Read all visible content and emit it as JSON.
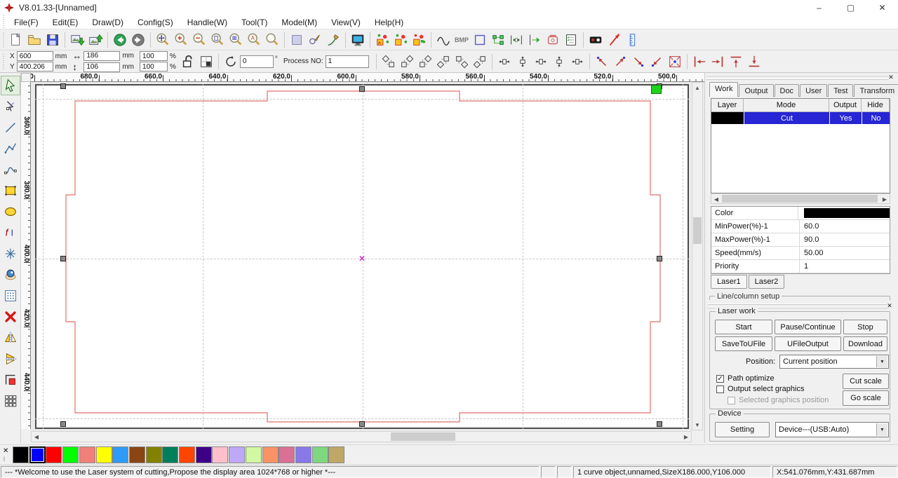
{
  "window": {
    "title": "V8.01.33-[Unnamed]",
    "logo_color": "#cc2222",
    "controls": {
      "minimize": "–",
      "maximize": "▢",
      "close": "✕"
    }
  },
  "menu": {
    "items": [
      "File(F)",
      "Edit(E)",
      "Draw(D)",
      "Config(S)",
      "Handle(W)",
      "Tool(T)",
      "Model(M)",
      "View(V)",
      "Help(H)"
    ]
  },
  "toolbar1": {
    "bmp_text": "BMP"
  },
  "fields": {
    "x_label": "X",
    "x_value": "600",
    "x_unit": "mm",
    "y_label": "Y",
    "y_value": "400.206",
    "y_unit": "mm",
    "w_value": "186",
    "w_unit": "mm",
    "h_value": "106",
    "h_unit": "mm",
    "sx_value": "100",
    "sx_unit": "%",
    "sy_value": "100",
    "sy_unit": "%",
    "rotate_value": "0",
    "rotate_unit": "°",
    "process_label": "Process NO:",
    "process_value": "1"
  },
  "rulers": {
    "top": [
      ".0",
      "680.0",
      "660.0",
      "640.0",
      "620.0",
      "600.0",
      "580.0",
      "560.0",
      "540.0",
      "520.0",
      "500.0"
    ],
    "left": [
      "360.0",
      "380.0",
      "400.0",
      "420.0",
      "440.0"
    ]
  },
  "canvas": {
    "object_outline_color": "#e0706a",
    "center_marker": "✕",
    "center_marker_color": "#cc00cc",
    "origin_marker_color": "#1ed41e",
    "grid_color": "#c8c8c8"
  },
  "panel": {
    "tabs": [
      "Work",
      "Output",
      "Doc",
      "User",
      "Test",
      "Transform"
    ],
    "active_tab": "Work",
    "layer_table": {
      "headers": [
        "Layer",
        "Mode",
        "Output",
        "Hide"
      ],
      "rows": [
        {
          "color": "#000000",
          "mode": "Cut",
          "output": "Yes",
          "hide": "No"
        }
      ],
      "selection_color": "#2626d4"
    },
    "properties": [
      {
        "label": "Color",
        "value": "",
        "swatch": "#000000"
      },
      {
        "label": "MinPower(%)-1",
        "value": "60.0"
      },
      {
        "label": "MaxPower(%)-1",
        "value": "90.0"
      },
      {
        "label": "Speed(mm/s)",
        "value": "50.00"
      },
      {
        "label": "Priority",
        "value": "1"
      }
    ],
    "laser_tabs": [
      "Laser1",
      "Laser2"
    ],
    "clipped_group": "Line/column setup"
  },
  "laser_work": {
    "title": "Laser work",
    "buttons_row1": [
      "Start",
      "Pause/Continue",
      "Stop"
    ],
    "buttons_row2": [
      "SaveToUFile",
      "UFileOutput",
      "Download"
    ],
    "position_label": "Position:",
    "position_value": "Current position",
    "checkboxes": [
      {
        "label": "Path optimize",
        "checked": true,
        "disabled": false
      },
      {
        "label": "Output select graphics",
        "checked": false,
        "disabled": false
      },
      {
        "label": "Selected graphics position",
        "checked": false,
        "disabled": true
      }
    ],
    "scale_buttons": [
      "Cut scale",
      "Go scale"
    ]
  },
  "device": {
    "title": "Device",
    "setting_button": "Setting",
    "device_value": "Device---(USB:Auto)"
  },
  "palette": {
    "colors": [
      "#000000",
      "#0000ff",
      "#ff0000",
      "#00ff00",
      "#f08078",
      "#ffff00",
      "#2e9bf8",
      "#8b4513",
      "#828200",
      "#007f5a",
      "#fc4503",
      "#3c0086",
      "#ffc0cb",
      "#bda9f8",
      "#d2f8a2",
      "#fa9266",
      "#da7093",
      "#8979e8",
      "#7fd87f",
      "#bfa768"
    ],
    "selected_index": 1
  },
  "status": {
    "message": "--- *Welcome to use the Laser system of cutting,Propose the display area 1024*768 or higher *---",
    "object_info": "1 curve object,unnamed,SizeX186.000,Y106.000",
    "cursor": "X:541.076mm,Y:431.687mm"
  }
}
